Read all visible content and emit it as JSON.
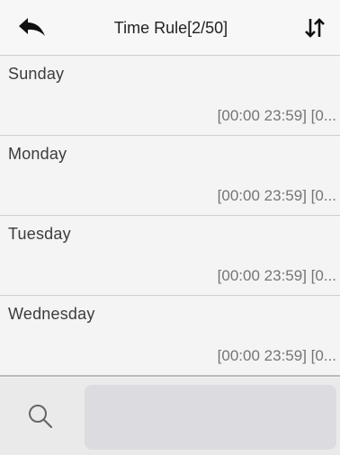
{
  "header": {
    "title": "Time Rule[2/50]",
    "back_icon": "back-arrow-icon",
    "sort_icon": "sort-icon"
  },
  "days": [
    {
      "name": "Sunday",
      "range": "[00:00 23:59] [0..."
    },
    {
      "name": "Monday",
      "range": "[00:00 23:59] [0..."
    },
    {
      "name": "Tuesday",
      "range": "[00:00 23:59] [0..."
    },
    {
      "name": "Wednesday",
      "range": "[00:00 23:59] [0..."
    }
  ],
  "search": {
    "icon": "search-icon",
    "value": ""
  }
}
